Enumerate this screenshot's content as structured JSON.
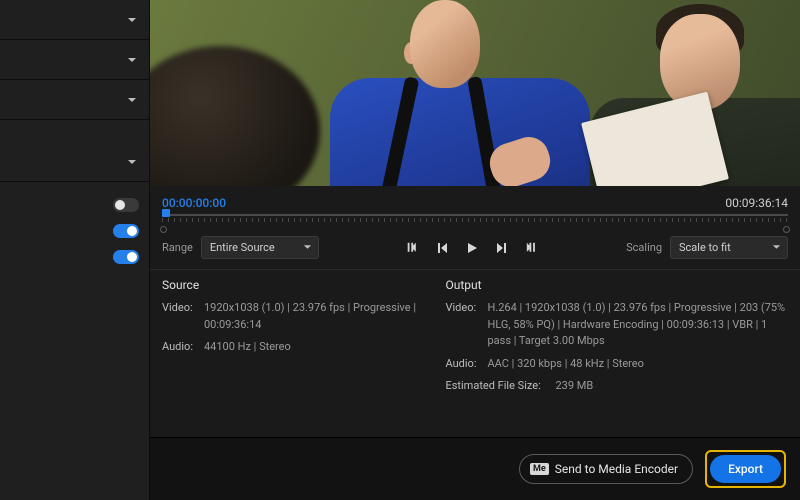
{
  "timeline": {
    "in_tc": "00:00:00:00",
    "out_tc": "00:09:36:14"
  },
  "range": {
    "label": "Range",
    "value": "Entire Source"
  },
  "scaling": {
    "label": "Scaling",
    "value": "Scale to fit"
  },
  "source": {
    "title": "Source",
    "video_key": "Video:",
    "video_val": "1920x1038 (1.0) | 23.976 fps | Progressive | 00:09:36:14",
    "audio_key": "Audio:",
    "audio_val": "44100 Hz | Stereo"
  },
  "output": {
    "title": "Output",
    "video_key": "Video:",
    "video_val": "H.264 | 1920x1038 (1.0) | 23.976 fps | Progressive | 203 (75% HLG, 58% PQ) | Hardware Encoding | 00:09:36:13 | VBR | 1 pass | Target 3.00 Mbps",
    "audio_key": "Audio:",
    "audio_val": "AAC | 320 kbps | 48 kHz | Stereo",
    "est_key": "Estimated File Size:",
    "est_val": "239 MB"
  },
  "footer": {
    "send_label": "Send to Media Encoder",
    "me_badge": "Me",
    "export_label": "Export"
  }
}
